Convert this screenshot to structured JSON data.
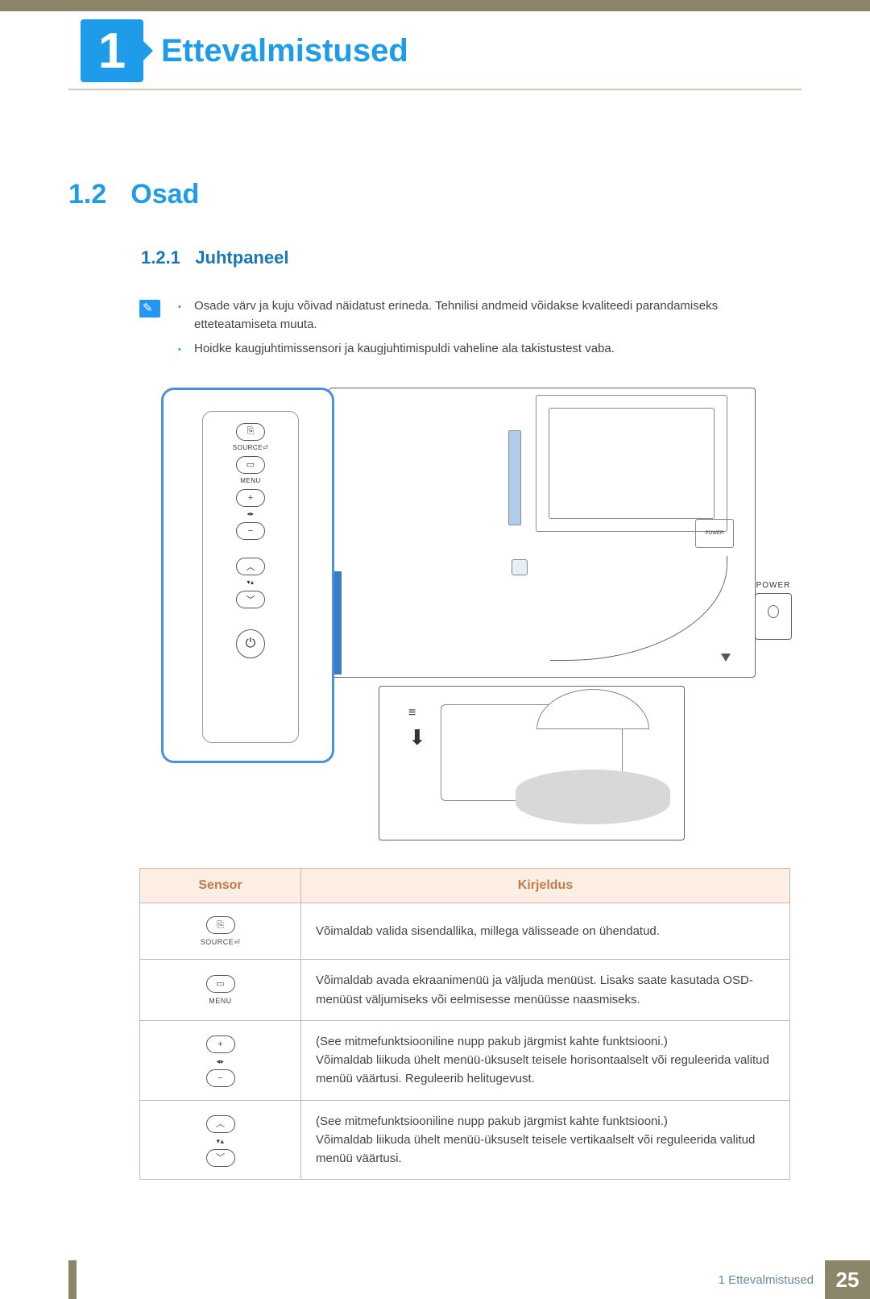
{
  "chapter": {
    "number": "1",
    "title": "Ettevalmistused"
  },
  "section": {
    "number": "1.2",
    "title": "Osad"
  },
  "subsection": {
    "number": "1.2.1",
    "title": "Juhtpaneel"
  },
  "notes": [
    "Osade värv ja kuju võivad näidatust erineda. Tehnilisi andmeid võidakse kvaliteedi parandamiseks etteteatamiseta muuta.",
    "Hoidke kaugjuhtimissensori ja kaugjuhtimispuldi vaheline ala takistustest vaba."
  ],
  "panel": {
    "source_icon": "⎘",
    "source_label": "SOURCE⏎",
    "menu_icon": "▭",
    "menu_label": "MENU",
    "plus": "+",
    "lr": "◂▸",
    "minus": "−",
    "up": "︿",
    "ud": "▾▴",
    "down": "﹀",
    "power": "⏻"
  },
  "diagram": {
    "power_port_label": "POWER",
    "power_detail_label": "POWER",
    "arrow": "⬇",
    "vent": "≡"
  },
  "table": {
    "headers": {
      "sensor": "Sensor",
      "desc": "Kirjeldus"
    },
    "rows": [
      {
        "icon_glyph": "⎘",
        "icon_label": "SOURCE⏎",
        "desc": "Võimaldab valida sisendallika, millega välisseade on ühendatud."
      },
      {
        "icon_glyph": "▭",
        "icon_label": "MENU",
        "desc": "Võimaldab avada ekraanimenüü ja väljuda menüüst. Lisaks saate kasutada OSD-menüüst väljumiseks või eelmisesse menüüsse naasmiseks."
      },
      {
        "icon_glyph_top": "+",
        "icon_mid": "◂▸",
        "icon_glyph_bot": "−",
        "desc": "(See mitmefunktsiooniline nupp pakub järgmist kahte funktsiooni.)\nVõimaldab liikuda ühelt menüü-üksuselt teisele horisontaalselt või reguleerida valitud menüü väärtusi. Reguleerib helitugevust."
      },
      {
        "icon_glyph_top": "︿",
        "icon_mid": "▾▴",
        "icon_glyph_bot": "﹀",
        "desc": "(See mitmefunktsiooniline nupp pakub järgmist kahte funktsiooni.)\nVõimaldab liikuda ühelt menüü-üksuselt teisele vertikaalselt või reguleerida valitud menüü väärtusi."
      }
    ]
  },
  "footer": {
    "text": "1 Ettevalmistused",
    "page": "25"
  }
}
